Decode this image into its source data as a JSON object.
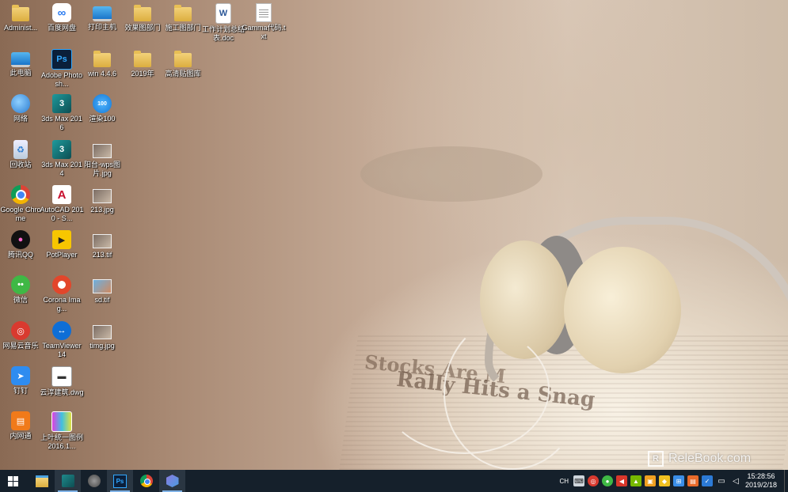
{
  "desktop": {
    "icons": [
      {
        "name": "administrator-folder-icon",
        "label": "Administ...",
        "type": "user"
      },
      {
        "name": "baidu-netdisk-icon",
        "label": "百度网盘",
        "type": "baidu"
      },
      {
        "name": "printer-host-icon",
        "label": "打印主机",
        "type": "pc"
      },
      {
        "name": "effects-dept-folder-icon",
        "label": "效果图部门",
        "type": "folder"
      },
      {
        "name": "construction-dept-folder-icon",
        "label": "施工图部门",
        "type": "folder"
      },
      {
        "name": "work-plan-doc-icon",
        "label": "工作计划总结表.doc",
        "type": "word"
      },
      {
        "name": "gamma-txt-icon",
        "label": "Gamma代码.txt",
        "type": "txt"
      },
      {
        "name": "this-pc-icon",
        "label": "此电脑",
        "type": "pc"
      },
      {
        "name": "photoshop-icon",
        "label": "Adobe Photosh...",
        "type": "ps"
      },
      {
        "name": "win446-folder-icon",
        "label": "win 4.4.6",
        "type": "folder"
      },
      {
        "name": "year-2019-folder-icon",
        "label": "2019年",
        "type": "folder"
      },
      {
        "name": "hd-texture-folder-icon",
        "label": "高清贴图库",
        "type": "folder"
      },
      {
        "name": "network-icon",
        "label": "网络",
        "type": "network"
      },
      {
        "name": "3dsmax-2016-icon",
        "label": "3ds Max 2016",
        "type": "max"
      },
      {
        "name": "render100-icon",
        "label": "渲染100",
        "type": "render"
      },
      {
        "name": "recycle-bin-icon",
        "label": "回收站",
        "type": "recycle"
      },
      {
        "name": "3dsmax-2014-icon",
        "label": "3ds Max 2014",
        "type": "max"
      },
      {
        "name": "balcony-wps-image-icon",
        "label": "阳台-wps图片.jpg",
        "type": "image"
      },
      {
        "name": "google-chrome-icon",
        "label": "Google Chrome",
        "type": "chrome"
      },
      {
        "name": "autocad-2010-icon",
        "label": "AutoCAD 2010 - S...",
        "type": "cad"
      },
      {
        "name": "image-213-jpg-icon",
        "label": "213.jpg",
        "type": "image"
      },
      {
        "name": "tencent-qq-icon",
        "label": "腾讯QQ",
        "type": "qq"
      },
      {
        "name": "potplayer-icon",
        "label": "PotPlayer",
        "type": "potplayer"
      },
      {
        "name": "image-213-tif-icon",
        "label": "213.tif",
        "type": "image"
      },
      {
        "name": "wechat-icon",
        "label": "微信",
        "type": "wechat"
      },
      {
        "name": "corona-image-icon",
        "label": "Corona Imag...",
        "type": "corona"
      },
      {
        "name": "image-sd-tif-icon",
        "label": "sd.tif",
        "type": "image2"
      },
      {
        "name": "netease-music-icon",
        "label": "网易云音乐",
        "type": "netease"
      },
      {
        "name": "teamviewer-icon",
        "label": "TeamViewer 14",
        "type": "teamviewer"
      },
      {
        "name": "image-timg-jpg-icon",
        "label": "timg.jpg",
        "type": "image"
      },
      {
        "name": "dingtalk-icon",
        "label": "钉钉",
        "type": "dingtalk"
      },
      {
        "name": "cloud-build-dwg-icon",
        "label": "云淳建筑.dwg",
        "type": "dwg"
      },
      {
        "name": "intranet-icon",
        "label": "内网通",
        "type": "intranet"
      },
      {
        "name": "legend-image-icon",
        "label": "上叶统一图例2016.1...",
        "type": "legend"
      }
    ],
    "watermark": "ReleBook.com"
  },
  "taskbar": {
    "input_method": "CH",
    "time": "15:28:56",
    "date": "2019/2/18"
  },
  "colors": {
    "taskbar_bg": "#15202b",
    "accent": "#7fb2e6"
  }
}
